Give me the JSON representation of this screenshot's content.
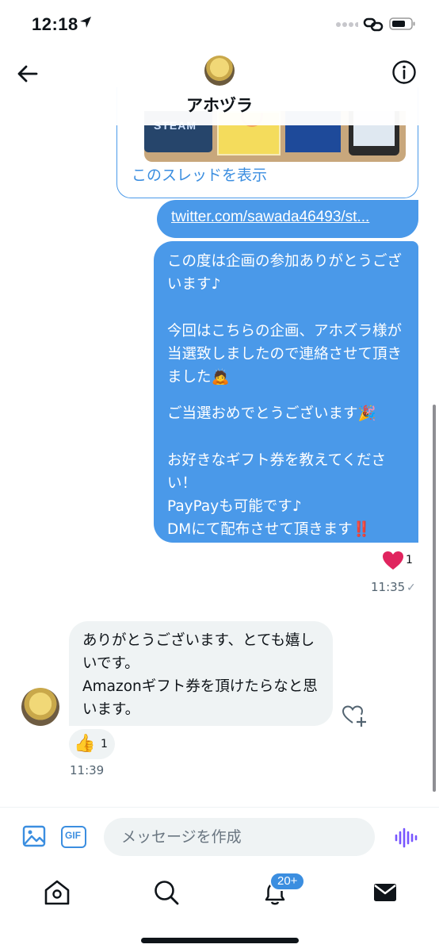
{
  "status_bar": {
    "time": "12:18"
  },
  "header": {
    "name": "アホヅラ"
  },
  "thread_card": {
    "image_label": "STEAM",
    "link_text": "このスレッドを表示"
  },
  "messages": {
    "link_message": "twitter.com/sawada46493/st...",
    "outgoing": {
      "p1": "この度は企画の参加ありがとうございます♪",
      "p2": "今回はこちらの企画、アホズラ様が当選致しましたので連絡させて頂きました🙇",
      "p3": "ご当選おめでとうございます🎉",
      "p4": "お好きなギフト券を教えてください！\nPayPayも可能です♪\nDMにて配布させて頂きます‼️",
      "reaction_count": "1",
      "time": "11:35",
      "read_mark": "✓"
    },
    "incoming": {
      "text": "ありがとうございます、とても嬉しいです。\nAmazonギフト券を頂けたらなと思います。",
      "reaction_emoji": "👍",
      "reaction_count": "1",
      "time": "11:39"
    }
  },
  "composer": {
    "gif_label": "GIF",
    "placeholder": "メッセージを作成"
  },
  "tabbar": {
    "notification_badge": "20+"
  },
  "colors": {
    "accent": "#4a99e9",
    "link": "#3b8ee0",
    "incoming_bubble": "#eff3f4",
    "heart": "#e0245e",
    "voice": "#7856ff"
  }
}
